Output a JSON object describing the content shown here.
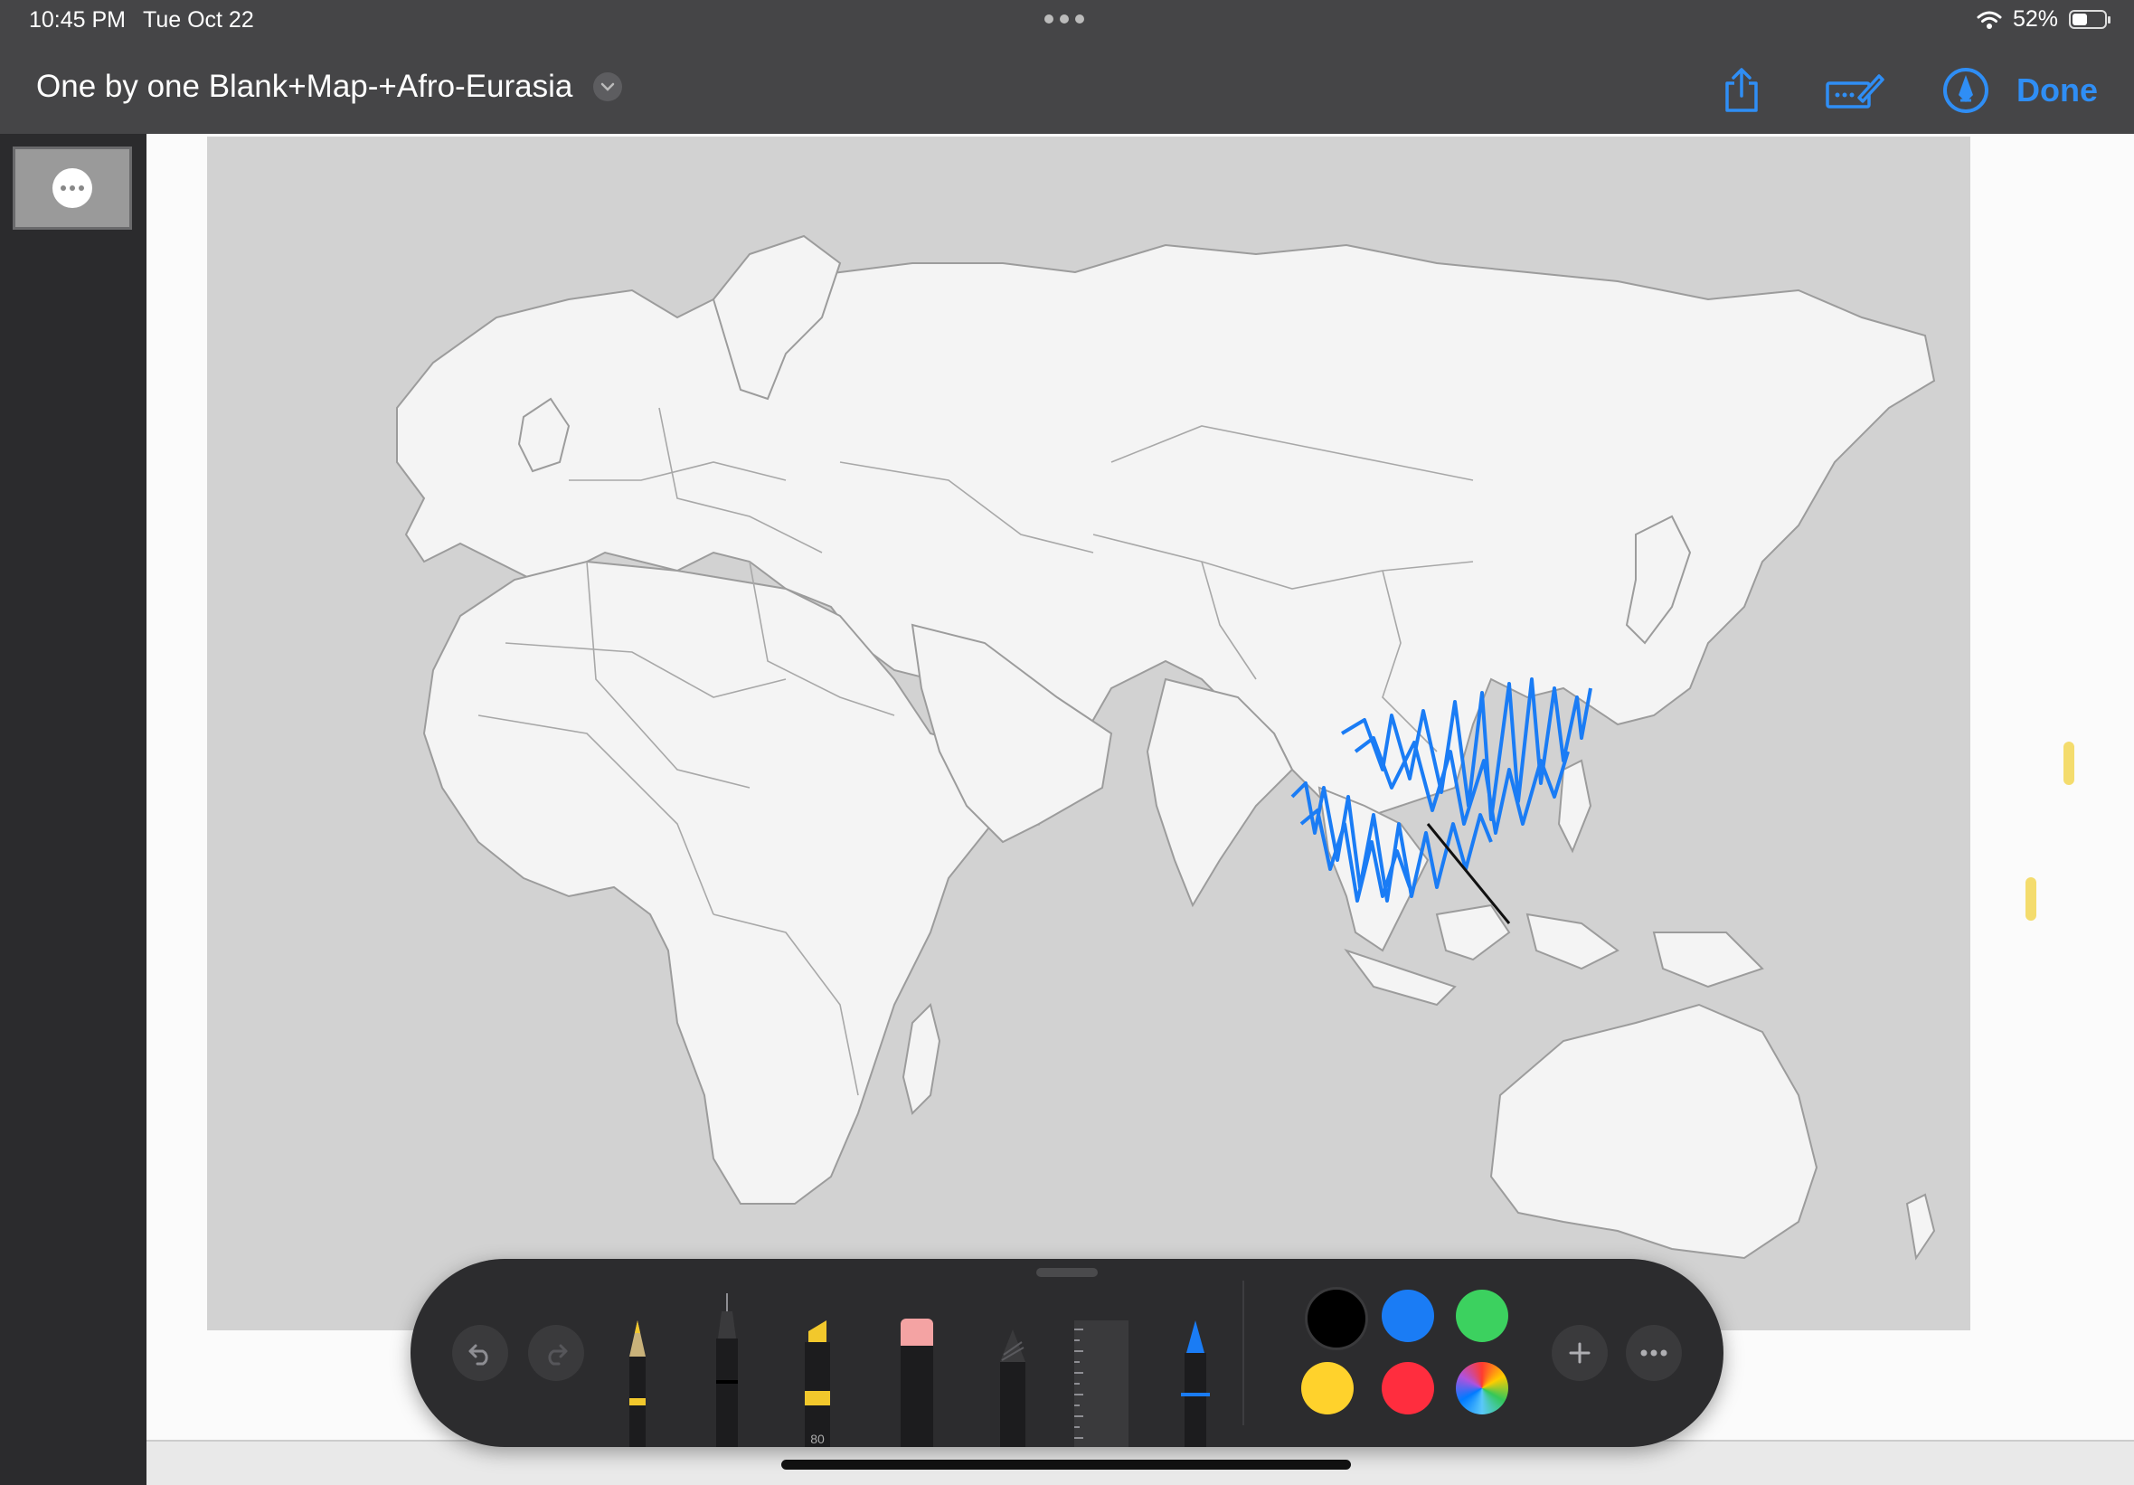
{
  "status_bar": {
    "time": "10:45 PM",
    "date": "Tue Oct 22",
    "battery": "52%",
    "battery_level": 0.52
  },
  "header": {
    "title": "One by one Blank+Map-+Afro-Eurasia",
    "done_label": "Done"
  },
  "icons": {
    "share": "share-icon",
    "markup_pen": "markup-pen-icon",
    "markup_toggle": "pencil-circle-icon",
    "chevron": "chevron-down-icon"
  },
  "palette": {
    "highlighter_opacity": "80",
    "colors": [
      {
        "name": "black",
        "hex": "#000000",
        "selected": true
      },
      {
        "name": "blue",
        "hex": "#1a7cf5",
        "selected": false
      },
      {
        "name": "green",
        "hex": "#3cd15f",
        "selected": false
      },
      {
        "name": "yellow",
        "hex": "#ffd22c",
        "selected": false
      },
      {
        "name": "red",
        "hex": "#ff2d3e",
        "selected": false
      },
      {
        "name": "multicolor",
        "hex": "conic",
        "selected": false
      }
    ],
    "accent": "#2f8ef5",
    "annotation_blue": "#1a7cf5"
  }
}
